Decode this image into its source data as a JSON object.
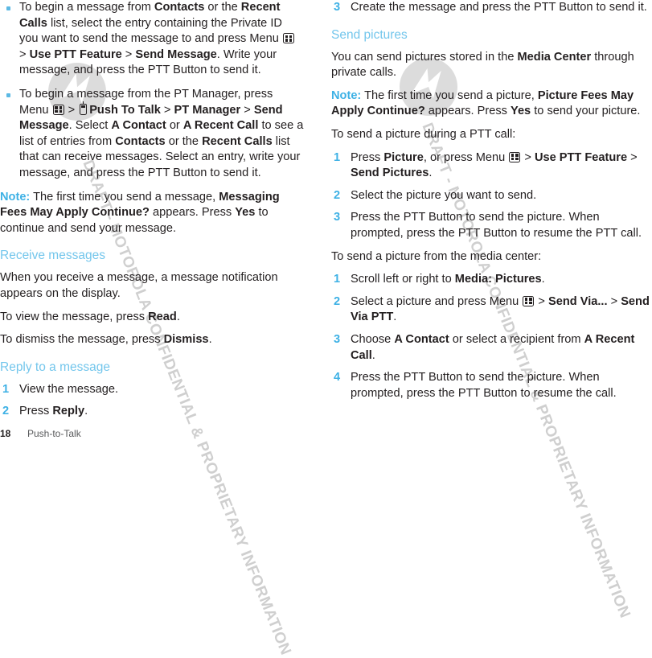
{
  "document": {
    "page_number": "18",
    "chapter": "Push-to-Talk",
    "watermark_text": "DRAFT - MOTOROLA CONFIDENTIAL & PROPRIETARY INFORMATION",
    "watermark_logo": "motorola-batwing-logo"
  },
  "colors": {
    "heading_blue": "#73c6ec",
    "note_blue": "#3eb1e5",
    "bullet_blue": "#5cb9e4",
    "number_blue": "#3eb1e5",
    "body_text": "#231f20",
    "watermark_gray": "#cfcfcf"
  },
  "left_column": {
    "bullets": [
      {
        "segments": [
          {
            "t": "To begin a message from ",
            "b": false
          },
          {
            "t": "Contacts",
            "b": true
          },
          {
            "t": " or the ",
            "b": false
          },
          {
            "t": "Recent Calls",
            "b": true
          },
          {
            "t": " list, select the entry containing the Private ID you want to send the message to and press Menu ",
            "b": false
          },
          {
            "t": "[menu-icon]",
            "b": false,
            "icon": "menu"
          },
          {
            "t": " > ",
            "b": false
          },
          {
            "t": "Use PTT Feature",
            "b": true
          },
          {
            "t": " > ",
            "b": false
          },
          {
            "t": "Send Message",
            "b": true
          },
          {
            "t": ". Write your message, and press the PTT Button to send it.",
            "b": false
          }
        ]
      },
      {
        "segments": [
          {
            "t": "To begin a message from the PT Manager, press Menu ",
            "b": false
          },
          {
            "t": "[menu-icon]",
            "b": false,
            "icon": "menu"
          },
          {
            "t": " > ",
            "b": false
          },
          {
            "t": "[ptt-icon]",
            "b": false,
            "icon": "ptt"
          },
          {
            "t": "Push To Talk",
            "b": true
          },
          {
            "t": " > ",
            "b": false
          },
          {
            "t": "PT Manager",
            "b": true
          },
          {
            "t": " > ",
            "b": false
          },
          {
            "t": "Send Message",
            "b": true
          },
          {
            "t": ". Select ",
            "b": false
          },
          {
            "t": "A Contact",
            "b": true
          },
          {
            "t": " or ",
            "b": false
          },
          {
            "t": "A Recent Call",
            "b": true
          },
          {
            "t": " to see a list of entries from ",
            "b": false
          },
          {
            "t": "Contacts",
            "b": true
          },
          {
            "t": " or the ",
            "b": false
          },
          {
            "t": "Recent Calls",
            "b": true
          },
          {
            "t": " list that can receive messages. Select an entry, write your message, and press the PTT Button to send it.",
            "b": false
          }
        ]
      }
    ],
    "note": {
      "label": "Note:",
      "segments": [
        {
          "t": " The first time you send a message, ",
          "b": false
        },
        {
          "t": "Messaging Fees May Apply Continue?",
          "b": true
        },
        {
          "t": " appears. Press ",
          "b": false
        },
        {
          "t": "Yes",
          "b": true
        },
        {
          "t": " to continue and send your message.",
          "b": false
        }
      ]
    },
    "section_receive": {
      "heading": "Receive messages",
      "paragraphs": [
        {
          "segments": [
            {
              "t": "When you receive a message, a message notification appears on the display.",
              "b": false
            }
          ]
        },
        {
          "segments": [
            {
              "t": "To view the message, press ",
              "b": false
            },
            {
              "t": "Read",
              "b": true
            },
            {
              "t": ".",
              "b": false
            }
          ]
        },
        {
          "segments": [
            {
              "t": "To dismiss the message, press ",
              "b": false
            },
            {
              "t": "Dismiss",
              "b": true
            },
            {
              "t": ".",
              "b": false
            }
          ]
        }
      ]
    },
    "section_reply": {
      "heading": "Reply to a message",
      "steps": [
        {
          "num": "1",
          "segments": [
            {
              "t": "View the message.",
              "b": false
            }
          ]
        },
        {
          "num": "2",
          "segments": [
            {
              "t": "Press ",
              "b": false
            },
            {
              "t": "Reply",
              "b": true
            },
            {
              "t": ".",
              "b": false
            }
          ]
        }
      ]
    }
  },
  "right_column": {
    "continued_steps": [
      {
        "num": "3",
        "segments": [
          {
            "t": "Create the message and press the PTT Button to send it.",
            "b": false
          }
        ]
      }
    ],
    "section_send_pictures": {
      "heading": "Send pictures",
      "intro": {
        "segments": [
          {
            "t": "You can send pictures stored in the ",
            "b": false
          },
          {
            "t": "Media Center",
            "b": true
          },
          {
            "t": " through private calls.",
            "b": false
          }
        ]
      },
      "note": {
        "label": "Note:",
        "segments": [
          {
            "t": " The first time you send a picture, ",
            "b": false
          },
          {
            "t": "Picture Fees May Apply Continue?",
            "b": true
          },
          {
            "t": " appears. Press ",
            "b": false
          },
          {
            "t": "Yes",
            "b": true
          },
          {
            "t": " to send your picture.",
            "b": false
          }
        ]
      },
      "lead_in_ptt_call": "To send a picture during a PTT call:",
      "steps_ptt_call": [
        {
          "num": "1",
          "segments": [
            {
              "t": "Press ",
              "b": false
            },
            {
              "t": "Picture",
              "b": true
            },
            {
              "t": ", or press Menu ",
              "b": false
            },
            {
              "t": "[menu-icon]",
              "b": false,
              "icon": "menu"
            },
            {
              "t": " > ",
              "b": false
            },
            {
              "t": "Use PTT Feature",
              "b": true
            },
            {
              "t": " > ",
              "b": false
            },
            {
              "t": "Send Pictures",
              "b": true
            },
            {
              "t": ".",
              "b": false
            }
          ]
        },
        {
          "num": "2",
          "segments": [
            {
              "t": "Select the picture you want to send.",
              "b": false
            }
          ]
        },
        {
          "num": "3",
          "segments": [
            {
              "t": "Press the PTT Button to send the picture. When prompted, press the PTT Button to resume the PTT call.",
              "b": false
            }
          ]
        }
      ],
      "lead_in_media_center": "To send a picture from the media center:",
      "steps_media_center": [
        {
          "num": "1",
          "segments": [
            {
              "t": "Scroll left or right to ",
              "b": false
            },
            {
              "t": "Media: Pictures",
              "b": true
            },
            {
              "t": ".",
              "b": false
            }
          ]
        },
        {
          "num": "2",
          "segments": [
            {
              "t": "Select a picture and press Menu ",
              "b": false
            },
            {
              "t": "[menu-icon]",
              "b": false,
              "icon": "menu"
            },
            {
              "t": " > ",
              "b": false
            },
            {
              "t": "Send Via...",
              "b": true
            },
            {
              "t": " > ",
              "b": false
            },
            {
              "t": "Send Via PTT",
              "b": true
            },
            {
              "t": ".",
              "b": false
            }
          ]
        },
        {
          "num": "3",
          "segments": [
            {
              "t": "Choose ",
              "b": false
            },
            {
              "t": "A Contact",
              "b": true
            },
            {
              "t": " or select a recipient from ",
              "b": false
            },
            {
              "t": "A Recent Call",
              "b": true
            },
            {
              "t": ".",
              "b": false
            }
          ]
        },
        {
          "num": "4",
          "segments": [
            {
              "t": "Press the PTT Button to send the picture. When prompted, press the PTT Button to resume the call.",
              "b": false
            }
          ]
        }
      ]
    }
  }
}
